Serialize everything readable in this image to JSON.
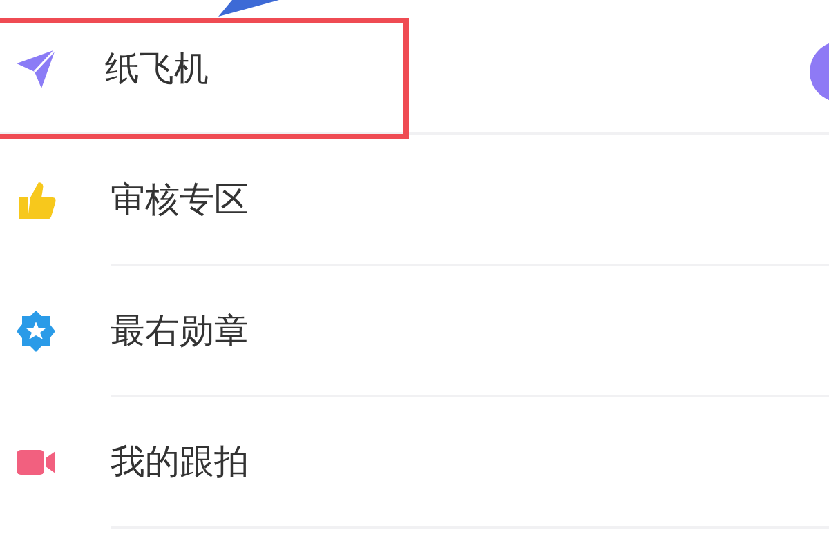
{
  "menu": {
    "items": [
      {
        "label": "纸飞机",
        "highlighted": true
      },
      {
        "label": "审核专区",
        "highlighted": false
      },
      {
        "label": "最右勋章",
        "highlighted": false
      },
      {
        "label": "我的跟拍",
        "highlighted": false
      }
    ]
  }
}
